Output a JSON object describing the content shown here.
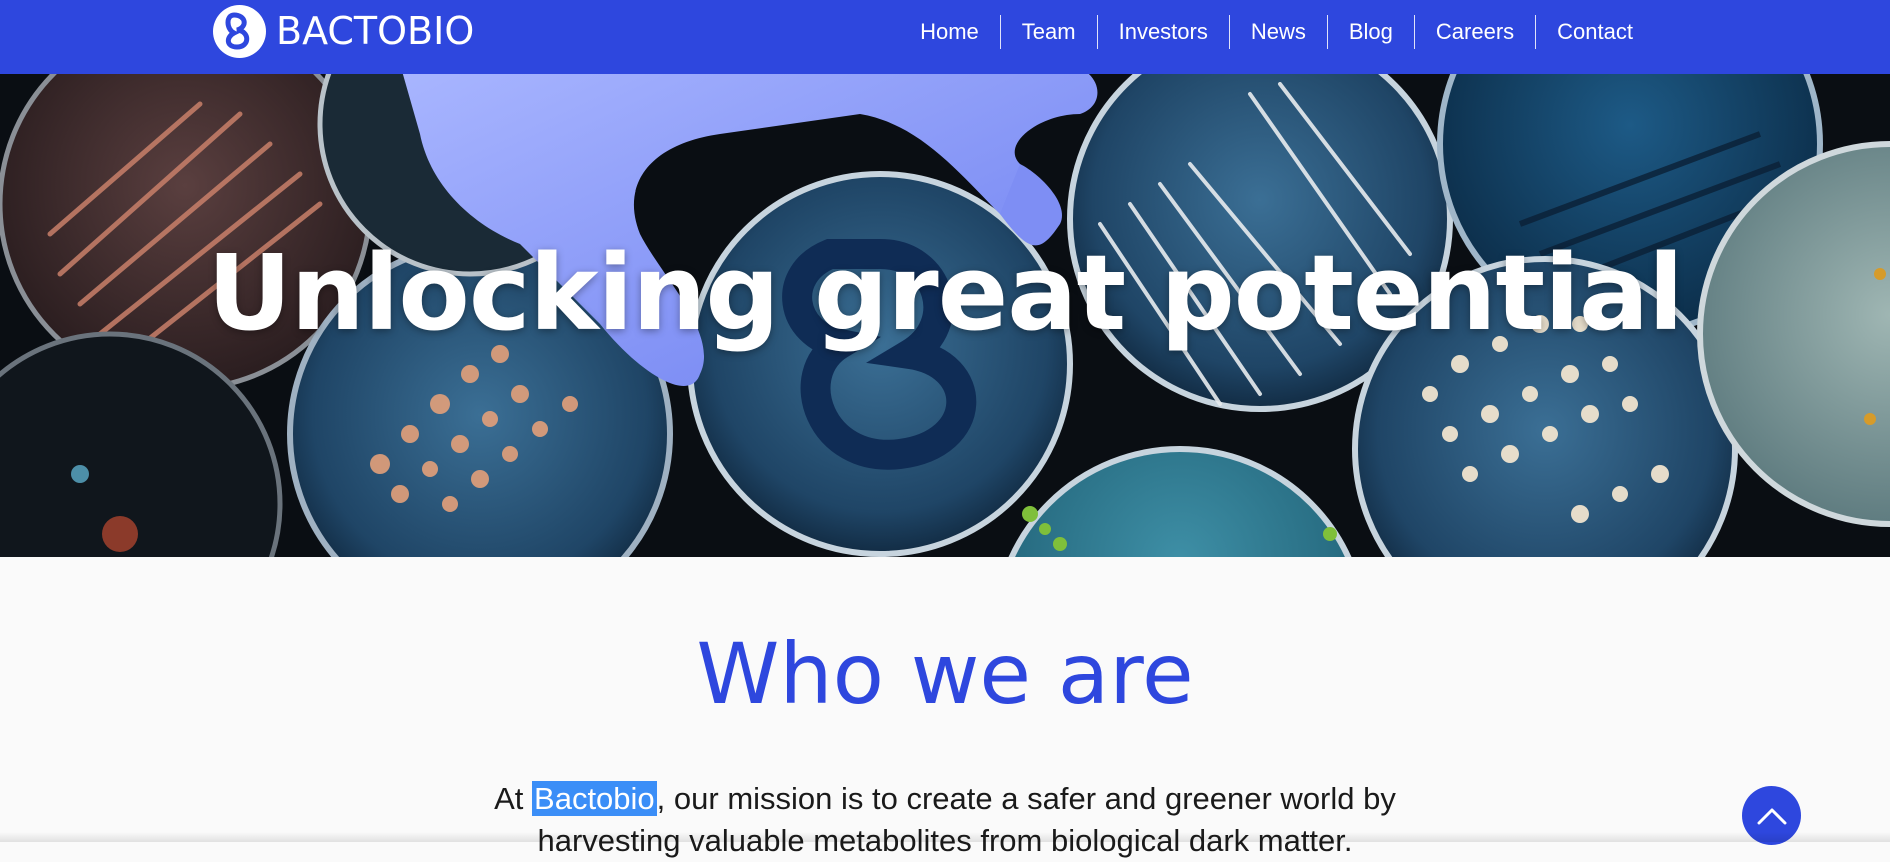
{
  "brand": {
    "name": "BACTOBIO",
    "logo_icon": "bactobio-b-logo-icon"
  },
  "nav": {
    "items": [
      {
        "label": "Home"
      },
      {
        "label": "Team"
      },
      {
        "label": "Investors"
      },
      {
        "label": "News"
      },
      {
        "label": "Blog"
      },
      {
        "label": "Careers"
      },
      {
        "label": "Contact"
      }
    ]
  },
  "hero": {
    "title": "Unlocking great potential",
    "image": "petri-dishes-with-gloved-hand"
  },
  "about": {
    "title": "Who we are",
    "text_prefix": "At ",
    "text_highlight": "Bactobio",
    "text_rest": ", our mission is to create a safer and greener world by harvesting valuable metabolites from biological dark matter."
  },
  "scroll_top": {
    "icon": "chevron-up-icon"
  },
  "colors": {
    "brand_blue": "#2e47de",
    "highlight": "#3b8ef7",
    "background": "#fafafa"
  }
}
